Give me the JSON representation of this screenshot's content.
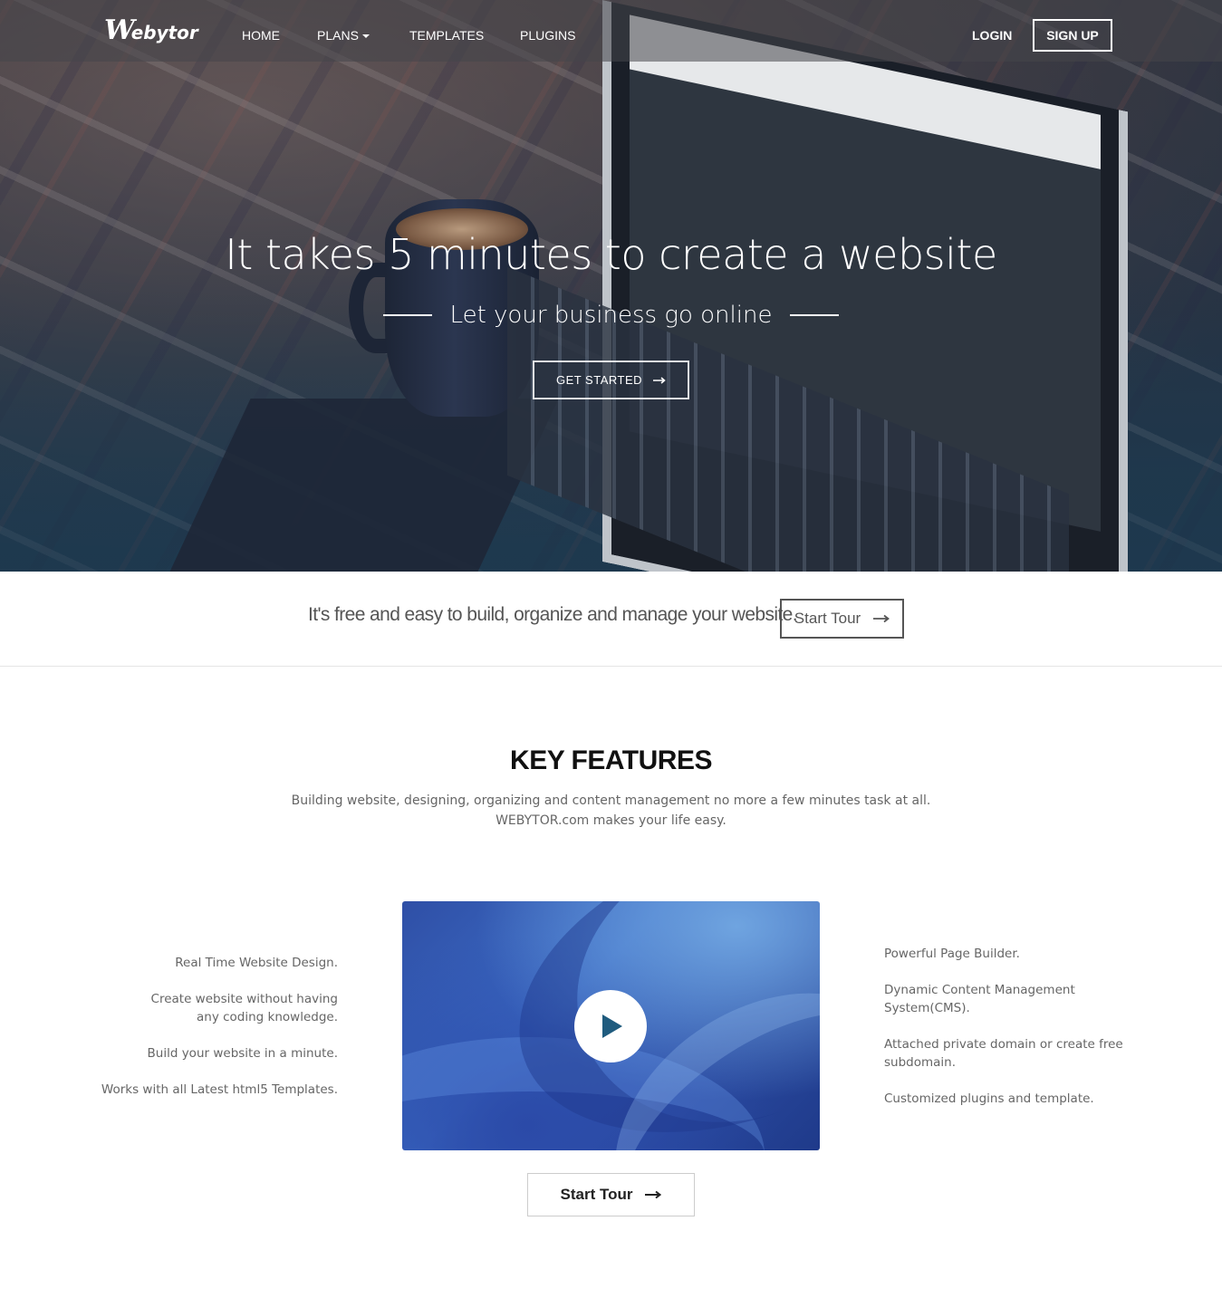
{
  "nav": {
    "logo_mark": "W",
    "logo_text": "ebytor",
    "items": [
      {
        "label": "HOME"
      },
      {
        "label": "PLANS",
        "has_dropdown": true
      },
      {
        "label": "TEMPLATES"
      },
      {
        "label": "PLUGINS"
      }
    ],
    "login": "LOGIN",
    "signup": "SIGN UP"
  },
  "hero": {
    "title": "It takes 5 minutes to create a website",
    "subtitle": "Let your business go online",
    "cta": "GET STARTED"
  },
  "tour_strip": {
    "text": "It's free and easy to build, organize and manage your website.",
    "button": "Start Tour"
  },
  "features": {
    "title": "KEY FEATURES",
    "desc_line1": "Building website, designing, organizing and content management no more a few minutes task at all.",
    "desc_line2": "WEBYTOR.com makes your life easy.",
    "left": [
      "Real Time Website Design.",
      "Create website without having any coding knowledge.",
      "Build your website in a minute.",
      "Works with all Latest html5 Templates."
    ],
    "right": [
      "Powerful Page Builder.",
      "Dynamic Content Management System(CMS).",
      "Attached private domain or create free subdomain.",
      "Customized plugins and template."
    ],
    "tour_button": "Start Tour"
  },
  "colors": {
    "play_icon": "#1f5b7e",
    "text_gray": "#666666"
  }
}
